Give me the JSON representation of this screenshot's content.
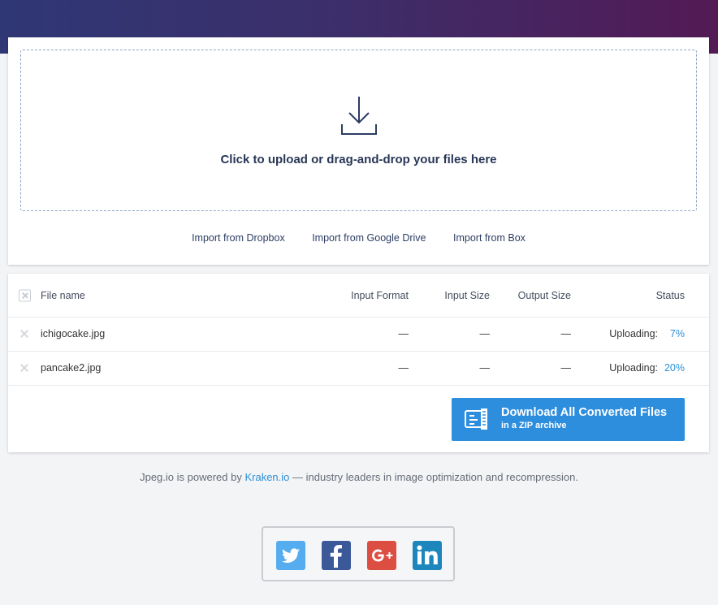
{
  "upload": {
    "drop_text": "Click to upload or drag-and-drop your files here",
    "imports": [
      "Import from Dropbox",
      "Import from Google Drive",
      "Import from Box"
    ]
  },
  "table": {
    "headers": {
      "file_name": "File name",
      "input_format": "Input Format",
      "input_size": "Input Size",
      "output_size": "Output Size",
      "status": "Status"
    },
    "rows": [
      {
        "name": "ichigocake.jpg",
        "input_format": "—",
        "input_size": "—",
        "output_size": "—",
        "status_label": "Uploading:",
        "status_pct": "7%"
      },
      {
        "name": "pancake2.jpg",
        "input_format": "—",
        "input_size": "—",
        "output_size": "—",
        "status_label": "Uploading:",
        "status_pct": "20%"
      }
    ]
  },
  "download": {
    "title": "Download All Converted Files",
    "subtitle": "in a ZIP archive"
  },
  "footer": {
    "prefix": "Jpeg.io is powered by",
    "link": "Kraken.io",
    "suffix": "— industry leaders in image optimization and recompression."
  },
  "social": {
    "icons": [
      "twitter-icon",
      "facebook-icon",
      "google-plus-icon",
      "linkedin-icon"
    ],
    "colors": {
      "twitter": "#55acee",
      "facebook": "#3b5998",
      "google_plus": "#dc4e41",
      "linkedin": "#1d87bd"
    }
  },
  "colors": {
    "accent": "#2e8ede",
    "link": "#2b8fd8",
    "header_start": "#2f3775",
    "header_end": "#531a55"
  }
}
